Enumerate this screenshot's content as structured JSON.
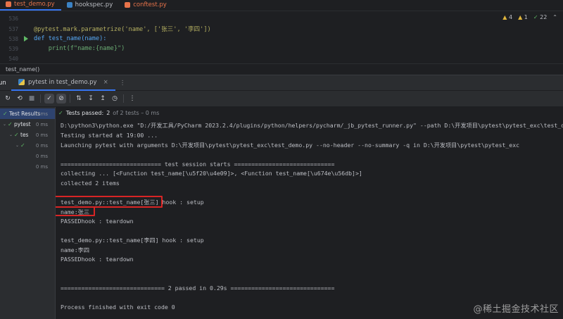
{
  "tabs": [
    {
      "label": "test_demo.py",
      "active": true,
      "icon_color": "#e8734a"
    },
    {
      "label": "hookspec.py",
      "active": false,
      "icon_color": "#3b82c4"
    },
    {
      "label": "conftest.py",
      "active": false,
      "icon_color": "#e8734a"
    }
  ],
  "editor": {
    "lines": [
      {
        "num": "536",
        "code": ""
      },
      {
        "num": "537",
        "code": "@pytest.mark.parametrize('name', ['张三', '李四'])"
      },
      {
        "num": "538",
        "code": "def test_name(name):"
      },
      {
        "num": "539",
        "code": "    print(f\"name:{name}\")"
      },
      {
        "num": "540",
        "code": ""
      }
    ],
    "inspections": {
      "warnings": "4",
      "weak": "1",
      "ok": "22"
    }
  },
  "breadcrumb": "test_name()",
  "run_window": {
    "label": "un",
    "tab_label": "pytest in test_demo.py"
  },
  "tree": [
    {
      "name": "Test Results",
      "time": "0 ms",
      "selected": true
    },
    {
      "name": "pytest",
      "time": "0 ms"
    },
    {
      "name": "tes",
      "time": "0 ms"
    },
    {
      "name": "",
      "time": "0 ms"
    },
    {
      "name": "",
      "time": "0 ms"
    },
    {
      "name": "",
      "time": "0 ms"
    }
  ],
  "console_header": {
    "status": "Tests passed:",
    "count": "2",
    "rest": "of 2 tests – 0 ms"
  },
  "console": [
    "D:\\python3\\python.exe \"D:/开发工具/PyCharm 2023.2.4/plugins/python/helpers/pycharm/_jb_pytest_runner.py\" --path D:\\开发项目\\pytest\\pytest_exc\\test_demo",
    "Testing started at 19:00 ...",
    "Launching pytest with arguments D:\\开发项目\\pytest\\pytest_exc\\test_demo.py --no-header --no-summary -q in D:\\开发项目\\pytest\\pytest_exc",
    "",
    "============================= test session starts =============================",
    "collecting ... [<Function test_name[\\u5f20\\u4e09]>, <Function test_name[\\u674e\\u56db]>]",
    "collected 2 items",
    "",
    "test_demo.py::test_name[张三] hook : setup",
    "name:张三",
    "PASSEDhook : teardown",
    "",
    "test_demo.py::test_name[李四] hook : setup",
    "name:李四",
    "PASSEDhook : teardown",
    "",
    "",
    "============================== 2 passed in 0.29s ==============================",
    "",
    "Process finished with exit code 0"
  ],
  "watermark": "@稀土掘金技术社区"
}
